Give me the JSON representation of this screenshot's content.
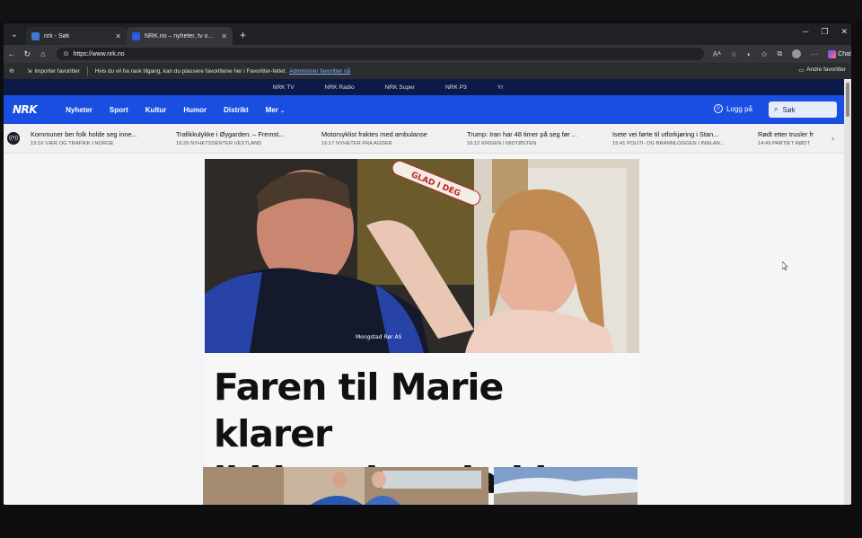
{
  "browser": {
    "tabs": [
      {
        "title": "nrk - Søk",
        "favicon_color": "#3a7bd5"
      },
      {
        "title": "NRK.no – nyheter, tv og radio fra hele landet",
        "favicon_color": "#2b5ce6"
      }
    ],
    "url": "https://www.nrk.no",
    "chat_label": "Chat"
  },
  "favorites_bar": {
    "import_label": "Importer favoritter",
    "hint_text": "Hvis du vil ha rask tilgang, kan du plassere favorittene her i Favoritter-feltet.",
    "manage_link": "Administrer favoritter nå",
    "other_label": "Andre favoritter"
  },
  "nrk": {
    "subnav": [
      "NRK TV",
      "NRK Radio",
      "NRK Super",
      "NRK P3",
      "Yr"
    ],
    "logo": "NRK",
    "nav": [
      "Nyheter",
      "Sport",
      "Kultur",
      "Humor",
      "Distrikt",
      "Mer"
    ],
    "login_label": "Logg på",
    "search_label": "Søk",
    "ticker": [
      {
        "headline": "Kommuner ber folk holde seg inne...",
        "meta": "19:16  VÆR OG TRAFIKK I NORGE"
      },
      {
        "headline": "Trafikkulykke i Øygarden: – Fremst...",
        "meta": "16:26  NYHETSSENTER VESTLAND"
      },
      {
        "headline": "Motorsyklist fraktes med ambulanse",
        "meta": "16:17  NYHETER FRA AGDER"
      },
      {
        "headline": "Trump: Iran har 48 timer på seg før ...",
        "meta": "16:12  KRIGEN I MIDTØSTEN"
      },
      {
        "headline": "Isete vei førte til utforkjøring i Stan...",
        "meta": "15:41  POLITI- OG BRANNLOGGEN I INNLAN..."
      },
      {
        "headline": "Rødt etter trusler fr",
        "meta": "14:49  PARTIET RØDT"
      }
    ],
    "hero": {
      "headline_line1": "Faren til Marie klarer",
      "headline_line2": "ikkje seie «glad i deg»",
      "prop_text": "GLAD I DEG",
      "shirt_text": "Mongstad Rør AS"
    }
  },
  "colors": {
    "nrk_blue": "#1a4ee0",
    "nrk_dark": "#0b1a46"
  }
}
